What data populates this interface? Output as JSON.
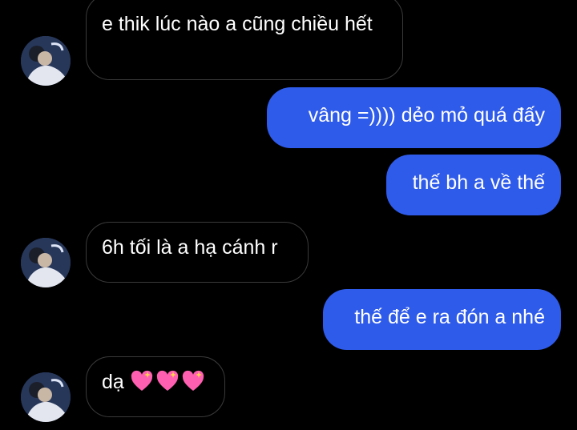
{
  "messages": [
    {
      "id": "m1",
      "side": "in",
      "text": "e thik lúc nào a cũng chiều hết"
    },
    {
      "id": "m2",
      "side": "out",
      "text": "vâng =)))) dẻo mỏ quá đấy"
    },
    {
      "id": "m3",
      "side": "out",
      "text": "thế bh a về thế"
    },
    {
      "id": "m4",
      "side": "in",
      "text": "6h tối là a hạ cánh r"
    },
    {
      "id": "m5",
      "side": "out",
      "text": "thế để e ra đón a nhé"
    },
    {
      "id": "m6",
      "side": "in",
      "text": "dạ",
      "emoji": [
        "sparkling-heart",
        "sparkling-heart",
        "sparkling-heart"
      ]
    }
  ],
  "colors": {
    "background": "#000000",
    "incoming_border": "#3a3a3a",
    "outgoing_bubble": "#2f5bea",
    "text": "#ffffff",
    "emoji_heart": "#ff5fb0"
  },
  "icons": {
    "avatar": "contact-avatar-photo"
  }
}
